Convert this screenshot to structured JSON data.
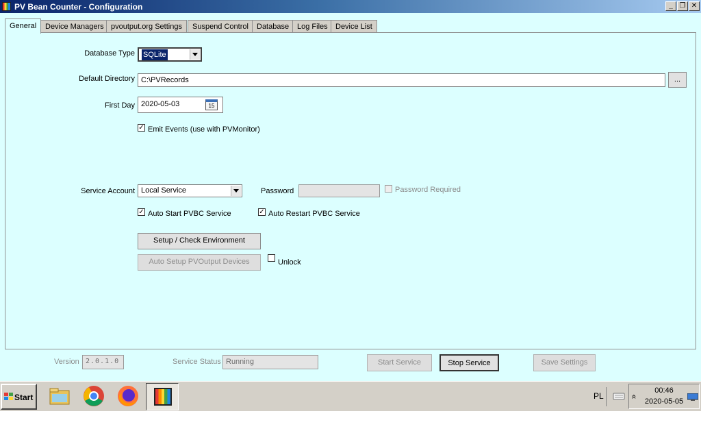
{
  "window": {
    "title": "PV Bean Counter - Configuration",
    "minimize_glyph": "_",
    "restore_glyph": "❐",
    "close_glyph": "✕"
  },
  "tabs": [
    {
      "label": "General",
      "active": true
    },
    {
      "label": "Device Managers"
    },
    {
      "label": "pvoutput.org Settings"
    },
    {
      "label": "Suspend Control"
    },
    {
      "label": "Database"
    },
    {
      "label": "Log Files"
    },
    {
      "label": "Device List"
    }
  ],
  "general": {
    "database_type": {
      "label": "Database Type",
      "value": "SQLite"
    },
    "default_directory": {
      "label": "Default Directory",
      "value": "C:\\PVRecords",
      "browse_label": "..."
    },
    "first_day": {
      "label": "First Day",
      "value": "2020-05-03",
      "calendar_day": "15"
    },
    "emit_events": {
      "label": "Emit Events (use with PVMonitor)",
      "checked": true
    },
    "service_account": {
      "label": "Service Account",
      "value": "Local Service"
    },
    "password": {
      "label": "Password",
      "value": ""
    },
    "password_required": {
      "label": "Password Required",
      "checked": false
    },
    "auto_start": {
      "label": "Auto Start PVBC Service",
      "checked": true
    },
    "auto_restart": {
      "label": "Auto Restart PVBC Service",
      "checked": true
    },
    "setup_button": "Setup / Check Environment",
    "auto_setup_button": "Auto Setup PVOutput Devices",
    "unlock": {
      "label": "Unlock",
      "checked": false
    }
  },
  "footer": {
    "version_label": "Version",
    "version_value": "2.0.1.0",
    "status_label": "Service Status",
    "status_value": "Running",
    "start_service": "Start Service",
    "stop_service": "Stop Service",
    "save_settings": "Save Settings"
  },
  "taskbar": {
    "start_label": "Start",
    "language": "PL",
    "tray_expand": "«",
    "time": "00:46",
    "date": "2020-05-05",
    "apps": [
      "file-explorer-icon",
      "chrome-icon",
      "firefox-icon",
      "pv-bean-counter-icon"
    ]
  },
  "colors": {
    "window_bg": "#dcffff",
    "selected_combo_bg": "#0a246a",
    "title_gradient_start": "#0a246a"
  }
}
